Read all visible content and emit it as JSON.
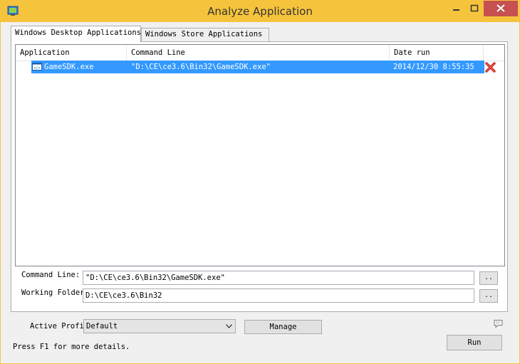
{
  "window": {
    "title": "Analyze Application"
  },
  "tabs": [
    {
      "label": "Windows Desktop Applications"
    },
    {
      "label": "Windows Store Applications"
    }
  ],
  "list": {
    "columns": [
      "Application",
      "Command Line",
      "Date run"
    ],
    "rows": [
      {
        "application": "GameSDK.exe",
        "command_line": "\"D:\\CE\\ce3.6\\Bin32\\GameSDK.exe\"",
        "date_run": "2014/12/30 8:55:35"
      }
    ]
  },
  "command_line": {
    "label": "Command Line:",
    "value": "\"D:\\CE\\ce3.6\\Bin32\\GameSDK.exe\"",
    "browse_label": ".."
  },
  "working_folder": {
    "label": "Working Folder",
    "value": "D:\\CE\\ce3.6\\Bin32",
    "browse_label": ".."
  },
  "profile": {
    "label": "Active Profil",
    "selected": "Default",
    "manage_label": "Manage"
  },
  "actions": {
    "run_label": "Run"
  },
  "status": {
    "text": "Press F1 for more details."
  },
  "colors": {
    "titlebar": "#f6c43c",
    "selection": "#3399ff",
    "close_button": "#c75050"
  },
  "icons": [
    "app-icon",
    "minimize-icon",
    "maximize-icon",
    "close-icon",
    "exe-icon",
    "delete-icon",
    "comment-icon",
    "dropdown-arrow-icon"
  ]
}
